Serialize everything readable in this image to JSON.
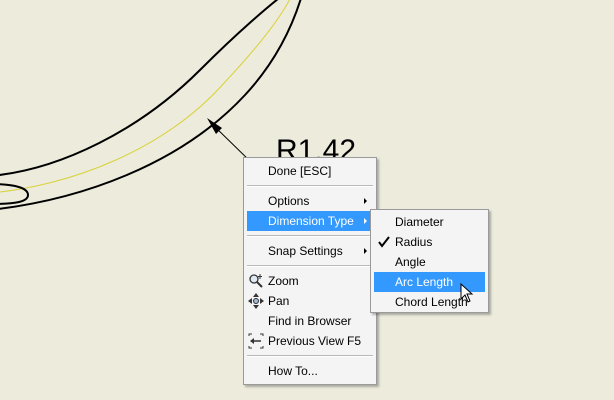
{
  "dimension_label": "R1.42",
  "main_menu": {
    "done": "Done [ESC]",
    "options": "Options",
    "dimension_type": "Dimension Type",
    "snap_settings": "Snap Settings",
    "zoom": "Zoom",
    "pan": "Pan",
    "find_in_browser": "Find in Browser",
    "previous_view": "Previous View",
    "previous_view_shortcut": "F5",
    "how_to": "How To..."
  },
  "dimension_type_menu": {
    "diameter": "Diameter",
    "radius": "Radius",
    "radius_checked": true,
    "angle": "Angle",
    "arc_length": "Arc Length",
    "chord_length": "Chord Length"
  },
  "colors": {
    "background": "#ecebdc",
    "highlight": "#3399ff",
    "construction_line": "#e3de3c"
  },
  "icons": [
    "zoom-icon",
    "pan-icon",
    "previous-view-icon",
    "checkmark-icon",
    "submenu-arrow-icon",
    "mouse-cursor-icon"
  ]
}
